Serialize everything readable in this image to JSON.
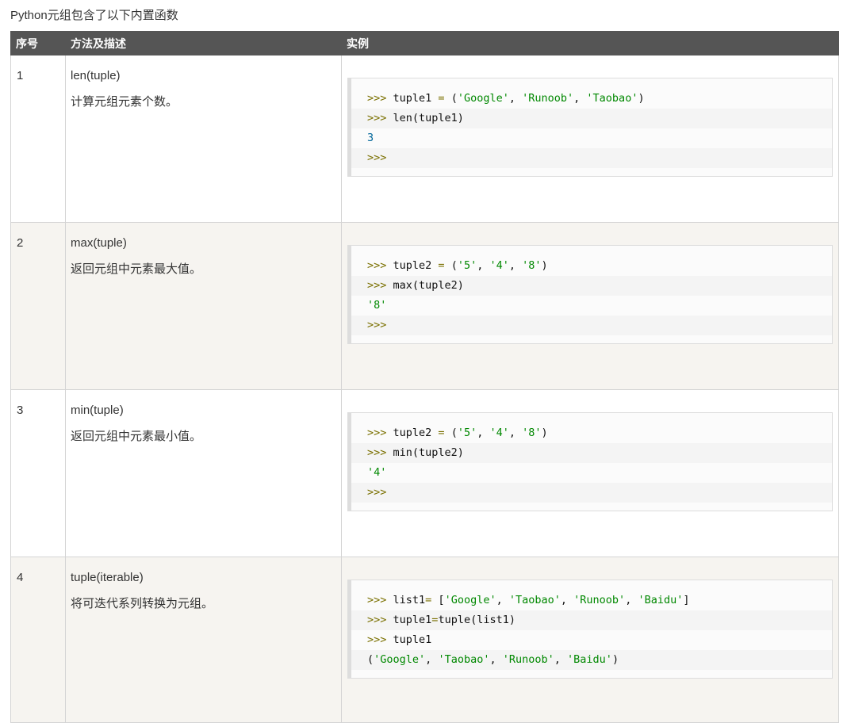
{
  "intro": "Python元组包含了以下内置函数",
  "headers": {
    "no": "序号",
    "method": "方法及描述",
    "example": "实例"
  },
  "rows": [
    {
      "no": "1",
      "method": "len(tuple)",
      "desc": "计算元组元素个数。",
      "code": [
        [
          [
            "p",
            ">>> "
          ],
          [
            "t",
            "tuple1 "
          ],
          [
            "o",
            "= "
          ],
          [
            "t",
            "("
          ],
          [
            "s",
            "'Google'"
          ],
          [
            "t",
            ", "
          ],
          [
            "s",
            "'Runoob'"
          ],
          [
            "t",
            ", "
          ],
          [
            "s",
            "'Taobao'"
          ],
          [
            "t",
            ")"
          ]
        ],
        [
          [
            "p",
            ">>> "
          ],
          [
            "t",
            "len(tuple1)"
          ]
        ],
        [
          [
            "n",
            "3"
          ]
        ],
        [
          [
            "p",
            ">>>"
          ]
        ]
      ]
    },
    {
      "no": "2",
      "method": "max(tuple)",
      "desc": "返回元组中元素最大值。",
      "code": [
        [
          [
            "p",
            ">>> "
          ],
          [
            "t",
            "tuple2 "
          ],
          [
            "o",
            "= "
          ],
          [
            "t",
            "("
          ],
          [
            "s",
            "'5'"
          ],
          [
            "t",
            ", "
          ],
          [
            "s",
            "'4'"
          ],
          [
            "t",
            ", "
          ],
          [
            "s",
            "'8'"
          ],
          [
            "t",
            ")"
          ]
        ],
        [
          [
            "p",
            ">>> "
          ],
          [
            "t",
            "max(tuple2)"
          ]
        ],
        [
          [
            "s",
            "'8'"
          ]
        ],
        [
          [
            "p",
            ">>>"
          ]
        ]
      ]
    },
    {
      "no": "3",
      "method": "min(tuple)",
      "desc": "返回元组中元素最小值。",
      "code": [
        [
          [
            "p",
            ">>> "
          ],
          [
            "t",
            "tuple2 "
          ],
          [
            "o",
            "= "
          ],
          [
            "t",
            "("
          ],
          [
            "s",
            "'5'"
          ],
          [
            "t",
            ", "
          ],
          [
            "s",
            "'4'"
          ],
          [
            "t",
            ", "
          ],
          [
            "s",
            "'8'"
          ],
          [
            "t",
            ")"
          ]
        ],
        [
          [
            "p",
            ">>> "
          ],
          [
            "t",
            "min(tuple2)"
          ]
        ],
        [
          [
            "s",
            "'4'"
          ]
        ],
        [
          [
            "p",
            ">>>"
          ]
        ]
      ]
    },
    {
      "no": "4",
      "method": "tuple(iterable)",
      "desc": "将可迭代系列转换为元组。",
      "code": [
        [
          [
            "p",
            ">>> "
          ],
          [
            "t",
            "list1"
          ],
          [
            "o",
            "= "
          ],
          [
            "t",
            "["
          ],
          [
            "s",
            "'Google'"
          ],
          [
            "t",
            ", "
          ],
          [
            "s",
            "'Taobao'"
          ],
          [
            "t",
            ", "
          ],
          [
            "s",
            "'Runoob'"
          ],
          [
            "t",
            ", "
          ],
          [
            "s",
            "'Baidu'"
          ],
          [
            "t",
            "]"
          ]
        ],
        [
          [
            "p",
            ">>> "
          ],
          [
            "t",
            "tuple1"
          ],
          [
            "o",
            "="
          ],
          [
            "t",
            "tuple(list1)"
          ]
        ],
        [
          [
            "p",
            ">>> "
          ],
          [
            "t",
            "tuple1"
          ]
        ],
        [
          [
            "t",
            "("
          ],
          [
            "s",
            "'Google'"
          ],
          [
            "t",
            ", "
          ],
          [
            "s",
            "'Taobao'"
          ],
          [
            "t",
            ", "
          ],
          [
            "s",
            "'Runoob'"
          ],
          [
            "t",
            ", "
          ],
          [
            "s",
            "'Baidu'"
          ],
          [
            "t",
            ")"
          ]
        ]
      ]
    }
  ]
}
